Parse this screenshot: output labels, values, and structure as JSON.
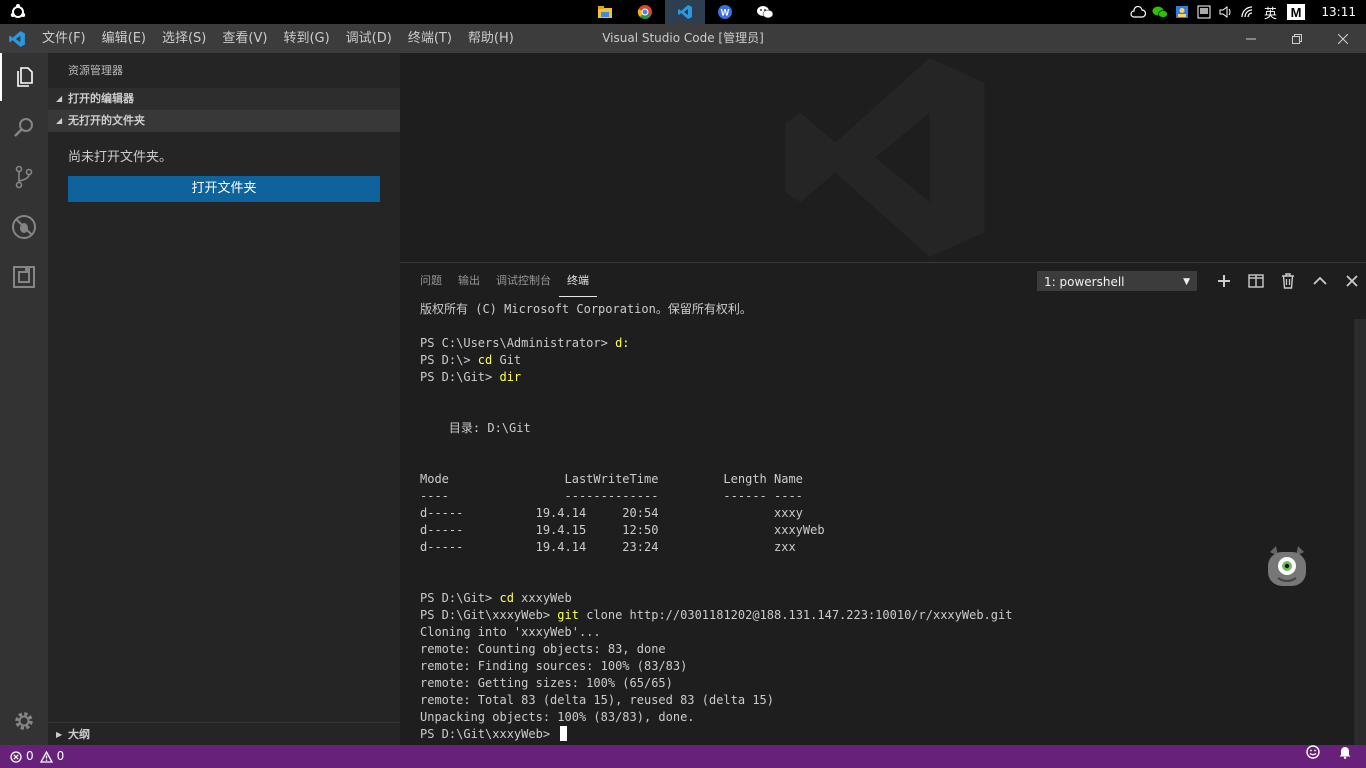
{
  "taskbar": {
    "clock": "13:11",
    "ime": "英",
    "apps": [
      "file-explorer-icon",
      "chrome-icon",
      "vscode-icon",
      "wps-icon",
      "wechat-icon"
    ]
  },
  "window": {
    "title": "Visual Studio Code [管理员]",
    "menus": [
      "文件(F)",
      "编辑(E)",
      "选择(S)",
      "查看(V)",
      "转到(G)",
      "调试(D)",
      "终端(T)",
      "帮助(H)"
    ]
  },
  "sidebar": {
    "title": "资源管理器",
    "sections": [
      "打开的编辑器",
      "无打开的文件夹"
    ],
    "no_folder_text": "尚未打开文件夹。",
    "open_folder_label": "打开文件夹",
    "outline_label": "大纲"
  },
  "panel": {
    "tabs": [
      "问题",
      "输出",
      "调试控制台",
      "终端"
    ],
    "active_tab": "终端",
    "terminal_select": "1: powershell"
  },
  "terminal": {
    "lines": [
      {
        "t": "版权所有 (C) Microsoft Corporation。保留所有权利。"
      },
      {
        "t": ""
      },
      {
        "p": "PS C:\\Users\\Administrator> ",
        "c": "d:"
      },
      {
        "p": "PS D:\\> ",
        "c": "cd",
        "a": " Git"
      },
      {
        "p": "PS D:\\Git> ",
        "c": "dir"
      },
      {
        "t": ""
      },
      {
        "t": ""
      },
      {
        "t": "    目录: D:\\Git"
      },
      {
        "t": ""
      },
      {
        "t": ""
      },
      {
        "t": "Mode                LastWriteTime         Length Name"
      },
      {
        "t": "----                -------------         ------ ----"
      },
      {
        "t": "d-----          19.4.14     20:54                xxxy"
      },
      {
        "t": "d-----          19.4.15     12:50                xxxyWeb"
      },
      {
        "t": "d-----          19.4.14     23:24                zxx"
      },
      {
        "t": ""
      },
      {
        "t": ""
      },
      {
        "p": "PS D:\\Git> ",
        "c": "cd",
        "a": " xxxyWeb"
      },
      {
        "p": "PS D:\\Git\\xxxyWeb> ",
        "c": "git",
        "a": " clone http://0301181202@188.131.147.223:10010/r/xxxyWeb.git"
      },
      {
        "t": "Cloning into 'xxxyWeb'..."
      },
      {
        "t": "remote: Counting objects: 83, done"
      },
      {
        "t": "remote: Finding sources: 100% (83/83)"
      },
      {
        "t": "remote: Getting sizes: 100% (65/65)"
      },
      {
        "t": "remote: Total 83 (delta 15), reused 83 (delta 15)"
      },
      {
        "t": "Unpacking objects: 100% (83/83), done."
      },
      {
        "p": "PS D:\\Git\\xxxyWeb> ",
        "cursor": true
      }
    ]
  },
  "statusbar": {
    "errors": "0",
    "warnings": "0"
  },
  "colors": {
    "statusbar": "#68217a",
    "button": "#0e639c",
    "command": "#ffff55"
  }
}
